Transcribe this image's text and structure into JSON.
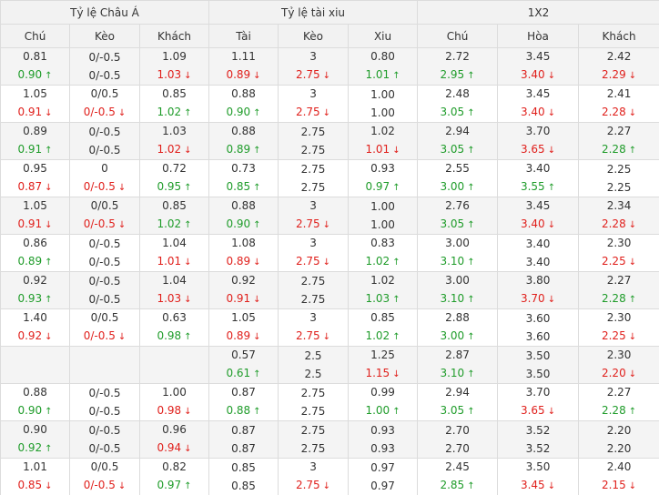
{
  "groups": [
    "Tỷ lệ Châu Á",
    "Tỷ lệ tài xiu",
    "1X2"
  ],
  "columns": [
    "Chú",
    "Kèo",
    "Khách",
    "Tài",
    "Kèo",
    "Xiu",
    "Chú",
    "Hòa",
    "Khách"
  ],
  "icons": {
    "up": "arrow-up-icon",
    "down": "arrow-down-icon"
  },
  "colors": {
    "up": "#1f9c2a",
    "down": "#e0201c",
    "header_bg": "#f2f2f2",
    "row_shade": "#f4f4f4"
  },
  "rows": [
    [
      [
        "0.81",
        "0.90",
        "u"
      ],
      [
        "0/-0.5",
        "0/-0.5",
        ""
      ],
      [
        "1.09",
        "1.03",
        "d"
      ],
      [
        "1.11",
        "0.89",
        "d"
      ],
      [
        "3",
        "2.75",
        "d"
      ],
      [
        "0.80",
        "1.01",
        "u"
      ],
      [
        "2.72",
        "2.95",
        "u"
      ],
      [
        "3.45",
        "3.40",
        "d"
      ],
      [
        "2.42",
        "2.29",
        "d"
      ]
    ],
    [
      [
        "1.05",
        "0.91",
        "d"
      ],
      [
        "0/0.5",
        "0/-0.5",
        "d"
      ],
      [
        "0.85",
        "1.02",
        "u"
      ],
      [
        "0.88",
        "0.90",
        "u"
      ],
      [
        "3",
        "2.75",
        "d"
      ],
      [
        "1.00",
        "1.00",
        ""
      ],
      [
        "2.48",
        "3.05",
        "u"
      ],
      [
        "3.45",
        "3.40",
        "d"
      ],
      [
        "2.41",
        "2.28",
        "d"
      ]
    ],
    [
      [
        "0.89",
        "0.91",
        "u"
      ],
      [
        "0/-0.5",
        "0/-0.5",
        ""
      ],
      [
        "1.03",
        "1.02",
        "d"
      ],
      [
        "0.88",
        "0.89",
        "u"
      ],
      [
        "2.75",
        "2.75",
        ""
      ],
      [
        "1.02",
        "1.01",
        "d"
      ],
      [
        "2.94",
        "3.05",
        "u"
      ],
      [
        "3.70",
        "3.65",
        "d"
      ],
      [
        "2.27",
        "2.28",
        "u"
      ]
    ],
    [
      [
        "0.95",
        "0.87",
        "d"
      ],
      [
        "0",
        "0/-0.5",
        "d"
      ],
      [
        "0.72",
        "0.95",
        "u"
      ],
      [
        "0.73",
        "0.85",
        "u"
      ],
      [
        "2.75",
        "2.75",
        ""
      ],
      [
        "0.93",
        "0.97",
        "u"
      ],
      [
        "2.55",
        "3.00",
        "u"
      ],
      [
        "3.40",
        "3.55",
        "u"
      ],
      [
        "2.25",
        "2.25",
        ""
      ]
    ],
    [
      [
        "1.05",
        "0.91",
        "d"
      ],
      [
        "0/0.5",
        "0/-0.5",
        "d"
      ],
      [
        "0.85",
        "1.02",
        "u"
      ],
      [
        "0.88",
        "0.90",
        "u"
      ],
      [
        "3",
        "2.75",
        "d"
      ],
      [
        "1.00",
        "1.00",
        ""
      ],
      [
        "2.76",
        "3.05",
        "u"
      ],
      [
        "3.45",
        "3.40",
        "d"
      ],
      [
        "2.34",
        "2.28",
        "d"
      ]
    ],
    [
      [
        "0.86",
        "0.89",
        "u"
      ],
      [
        "0/-0.5",
        "0/-0.5",
        ""
      ],
      [
        "1.04",
        "1.01",
        "d"
      ],
      [
        "1.08",
        "0.89",
        "d"
      ],
      [
        "3",
        "2.75",
        "d"
      ],
      [
        "0.83",
        "1.02",
        "u"
      ],
      [
        "3.00",
        "3.10",
        "u"
      ],
      [
        "3.40",
        "3.40",
        ""
      ],
      [
        "2.30",
        "2.25",
        "d"
      ]
    ],
    [
      [
        "0.92",
        "0.93",
        "u"
      ],
      [
        "0/-0.5",
        "0/-0.5",
        ""
      ],
      [
        "1.04",
        "1.03",
        "d"
      ],
      [
        "0.92",
        "0.91",
        "d"
      ],
      [
        "2.75",
        "2.75",
        ""
      ],
      [
        "1.02",
        "1.03",
        "u"
      ],
      [
        "3.00",
        "3.10",
        "u"
      ],
      [
        "3.80",
        "3.70",
        "d"
      ],
      [
        "2.27",
        "2.28",
        "u"
      ]
    ],
    [
      [
        "1.40",
        "0.92",
        "d"
      ],
      [
        "0/0.5",
        "0/-0.5",
        "d"
      ],
      [
        "0.63",
        "0.98",
        "u"
      ],
      [
        "1.05",
        "0.89",
        "d"
      ],
      [
        "3",
        "2.75",
        "d"
      ],
      [
        "0.85",
        "1.02",
        "u"
      ],
      [
        "2.88",
        "3.00",
        "u"
      ],
      [
        "3.60",
        "3.60",
        ""
      ],
      [
        "2.30",
        "2.25",
        "d"
      ]
    ],
    [
      [
        "",
        "",
        ""
      ],
      [
        "",
        "",
        ""
      ],
      [
        "",
        "",
        ""
      ],
      [
        "0.57",
        "0.61",
        "u"
      ],
      [
        "2.5",
        "2.5",
        ""
      ],
      [
        "1.25",
        "1.15",
        "d"
      ],
      [
        "2.87",
        "3.10",
        "u"
      ],
      [
        "3.50",
        "3.50",
        ""
      ],
      [
        "2.30",
        "2.20",
        "d"
      ]
    ],
    [
      [
        "0.88",
        "0.90",
        "u"
      ],
      [
        "0/-0.5",
        "0/-0.5",
        ""
      ],
      [
        "1.00",
        "0.98",
        "d"
      ],
      [
        "0.87",
        "0.88",
        "u"
      ],
      [
        "2.75",
        "2.75",
        ""
      ],
      [
        "0.99",
        "1.00",
        "u"
      ],
      [
        "2.94",
        "3.05",
        "u"
      ],
      [
        "3.70",
        "3.65",
        "d"
      ],
      [
        "2.27",
        "2.28",
        "u"
      ]
    ],
    [
      [
        "0.90",
        "0.92",
        "u"
      ],
      [
        "0/-0.5",
        "0/-0.5",
        ""
      ],
      [
        "0.96",
        "0.94",
        "d"
      ],
      [
        "0.87",
        "0.87",
        ""
      ],
      [
        "2.75",
        "2.75",
        ""
      ],
      [
        "0.93",
        "0.93",
        ""
      ],
      [
        "2.70",
        "2.70",
        ""
      ],
      [
        "3.52",
        "3.52",
        ""
      ],
      [
        "2.20",
        "2.20",
        ""
      ]
    ],
    [
      [
        "1.01",
        "0.85",
        "d"
      ],
      [
        "0/0.5",
        "0/-0.5",
        "d"
      ],
      [
        "0.82",
        "0.97",
        "u"
      ],
      [
        "0.85",
        "0.85",
        ""
      ],
      [
        "3",
        "2.75",
        "d"
      ],
      [
        "0.97",
        "0.97",
        ""
      ],
      [
        "2.45",
        "2.85",
        "u"
      ],
      [
        "3.50",
        "3.45",
        "d"
      ],
      [
        "2.40",
        "2.15",
        "d"
      ]
    ]
  ]
}
